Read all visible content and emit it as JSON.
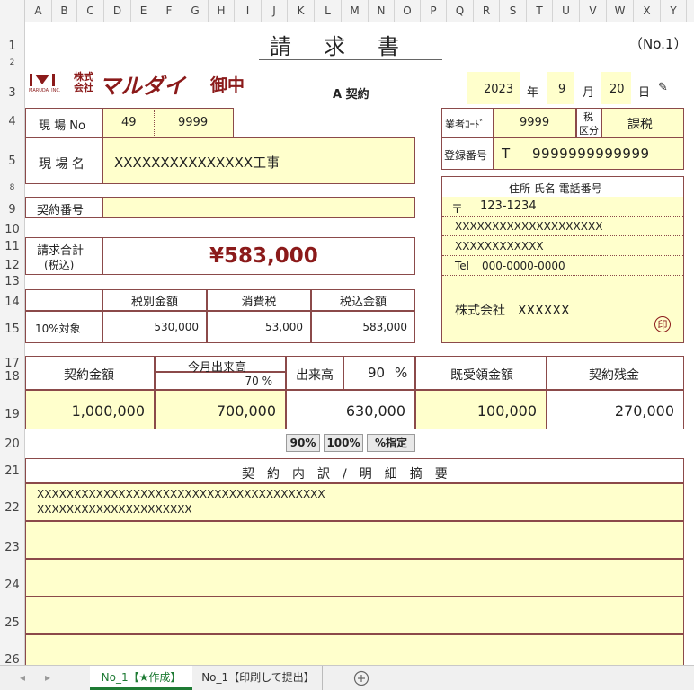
{
  "columns": [
    "A",
    "B",
    "C",
    "D",
    "E",
    "F",
    "G",
    "H",
    "I",
    "J",
    "K",
    "L",
    "M",
    "N",
    "O",
    "P",
    "Q",
    "R",
    "S",
    "T",
    "U",
    "V",
    "W",
    "X",
    "Y"
  ],
  "rows": [
    "1",
    "2",
    "3",
    "4",
    "5",
    "8",
    "9",
    "10",
    "11",
    "12",
    "13",
    "14",
    "15",
    "17",
    "18",
    "19",
    "20",
    "21",
    "22",
    "23",
    "24",
    "25",
    "26"
  ],
  "header": {
    "title": "請　求　書",
    "page_no": "（No.1）",
    "company_kabu": "株式",
    "company_kai": "会社",
    "company_name": "マルダイ",
    "logo_small": "MARUDAI INC.",
    "onchu": "御中",
    "contract_type": "A 契約",
    "year": "2023",
    "year_label": "年",
    "month": "9",
    "month_label": "月",
    "day": "20",
    "day_label": "日"
  },
  "site": {
    "site_no_label": "現 場 No",
    "site_no_1": "49",
    "site_no_2": "9999",
    "site_name_label": "現 場 名",
    "site_name": "XXXXXXXXXXXXXXX工事",
    "contract_no_label": "契約番号",
    "contract_no": ""
  },
  "vendor": {
    "code_label": "業者ｺｰﾄﾞ",
    "code": "9999",
    "tax_label_1": "税",
    "tax_label_2": "区分",
    "tax_value": "課税",
    "reg_label": "登録番号",
    "reg_prefix": "T",
    "reg_no": "9999999999999",
    "addr_header": "住所 氏名 電話番号",
    "zip_mark": "〒",
    "zip": "123-1234",
    "addr1": "XXXXXXXXXXXXXXXXXXXX",
    "addr2": "XXXXXXXXXXXX",
    "tel_label": "Tel",
    "tel": "000-0000-0000",
    "name": "株式会社　XXXXXX",
    "seal": "印"
  },
  "total": {
    "label_1": "請求合計",
    "label_2": "(税込)",
    "amount": "¥583,000"
  },
  "tax_table": {
    "headers": [
      "税別金額",
      "消費税",
      "税込金額"
    ],
    "row_label": "10%対象",
    "values": [
      "530,000",
      "53,000",
      "583,000"
    ]
  },
  "progress": {
    "contract_amount_label": "契約金額",
    "this_month_label": "今月出来高",
    "this_month_pct": "70 %",
    "output_label": "出来高",
    "output_pct": "90",
    "output_pct_unit": "%",
    "received_label": "既受領金額",
    "remaining_label": "契約残金",
    "contract_amount": "1,000,000",
    "this_month_amount": "700,000",
    "output_amount": "630,000",
    "received_amount": "100,000",
    "remaining_amount": "270,000"
  },
  "buttons": {
    "b90": "90%",
    "b100": "100%",
    "bspec": "%指定"
  },
  "detail": {
    "header": "契　約　内　訳　/　明　細　摘　要",
    "line1": "XXXXXXXXXXXXXXXXXXXXXXXXXXXXXXXXXXXXXXX",
    "line2": "XXXXXXXXXXXXXXXXXXXXX"
  },
  "sheet_tabs": [
    "No_1【★作成】",
    "No_1【印刷して提出】"
  ],
  "colors": {
    "accent": "#8b1a1a",
    "cell_fill": "#ffffcc",
    "border": "#8b4a4a",
    "tab_active": "#1e7b34"
  }
}
